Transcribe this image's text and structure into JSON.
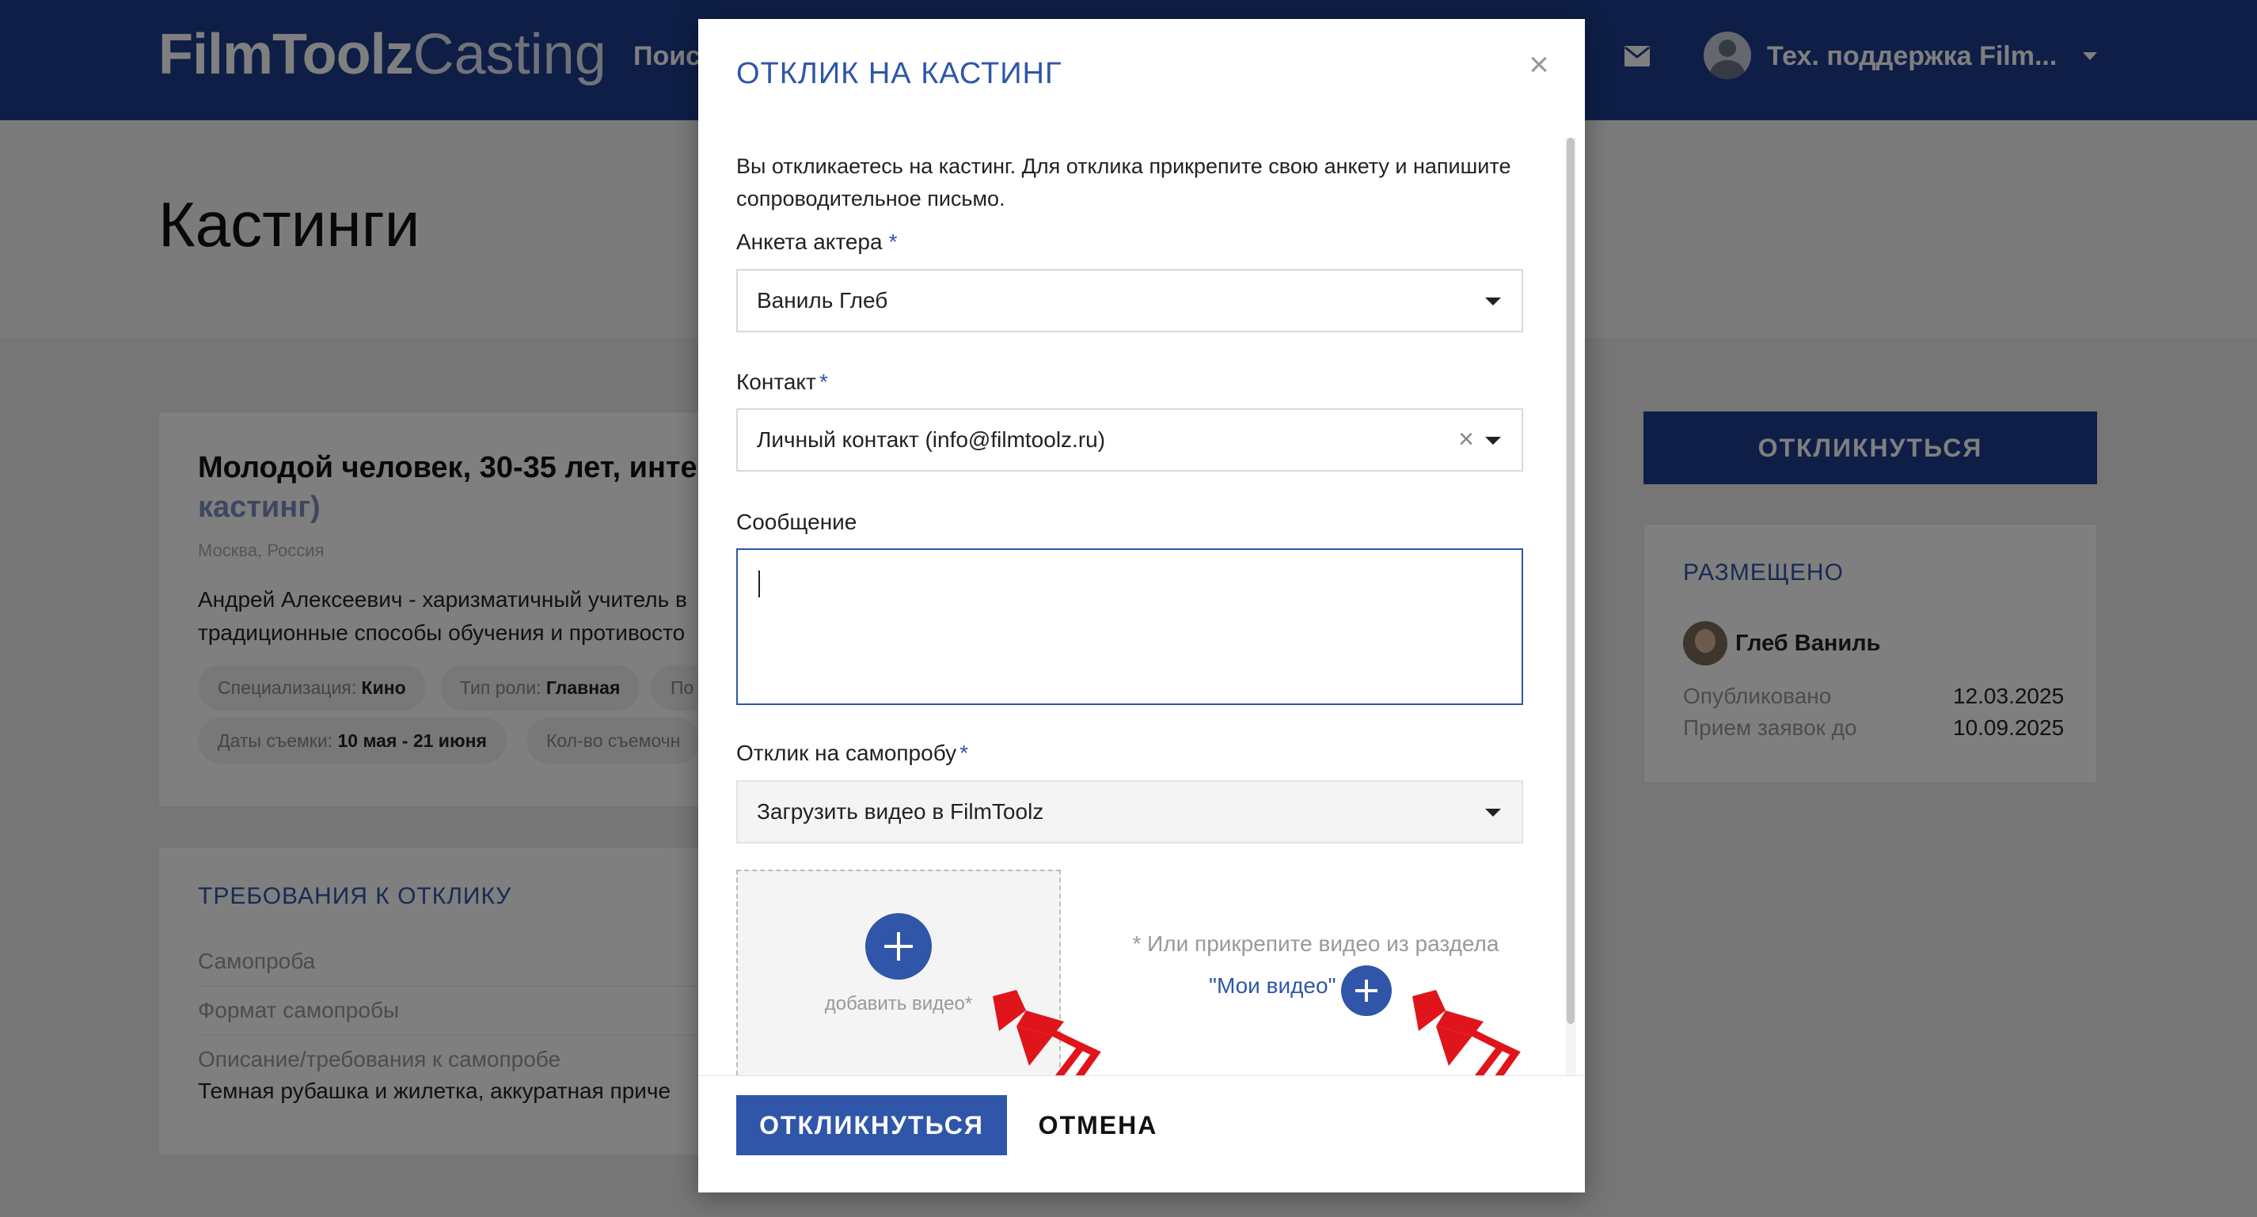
{
  "header": {
    "logo_bold": "FilmToolz",
    "logo_thin": "Casting",
    "nav_search": "Поиск",
    "user_name": "Тех. поддержка Film...",
    "icons": [
      "mail-icon",
      "user-avatar",
      "chevron-down-icon"
    ]
  },
  "page": {
    "title": "Кастинги"
  },
  "casting": {
    "title": "Молодой человек, 30-35 лет, инте",
    "title_tail": "кастинг)",
    "location": "Москва, Россия",
    "description": "Андрей Алексеевич - харизматичный учитель в традиционные способы обучения и противосто",
    "chips": [
      {
        "label": "Специализация:",
        "value": "Кино"
      },
      {
        "label": "Тип роли:",
        "value": "Главная"
      },
      {
        "label": "По",
        "value": ""
      },
      {
        "label": "Даты съемки:",
        "value": "10 мая - 21 июня"
      },
      {
        "label": "Кол-во съемочн",
        "value": ""
      }
    ]
  },
  "requirements": {
    "title": "ТРЕБОВАНИЯ К ОТКЛИКУ",
    "rows": [
      "Самопроба",
      "Формат самопробы",
      "Описание/требования к самопробе"
    ],
    "text": "Темная рубашка и жилетка, аккуратная приче"
  },
  "sidebar": {
    "respond_button": "ОТКЛИКНУТЬСЯ",
    "posted_title": "РАЗМЕЩЕНО",
    "poster_name": "Глеб Ваниль",
    "published_label": "Опубликовано",
    "published_value": "12.03.2025",
    "deadline_label": "Прием заявок до",
    "deadline_value": "10.09.2025"
  },
  "modal": {
    "title": "ОТКЛИК НА КАСТИНГ",
    "close": "×",
    "intro": "Вы откликаетесь на кастинг. Для отклика прикрепите свою анкету и напишите сопроводительное письмо.",
    "profile_label": "Анкета актера",
    "profile_value": "Ваниль Глеб",
    "contact_label": "Контакт",
    "contact_value": "Личный контакт (info@filmtoolz.ru)",
    "message_label": "Сообщение",
    "message_value": "",
    "selftape_label": "Отклик на самопробу",
    "selftape_value": "Загрузить видео в FilmToolz",
    "required_mark": "*",
    "add_video_label": "добавить видео*",
    "alt_text": "* Или прикрепите видео из раздела",
    "my_videos_link": "\"Мои видео\"",
    "submit_button": "ОТКЛИКНУТЬСЯ",
    "cancel_button": "ОТМЕНА",
    "clear_icon": "×"
  },
  "colors": {
    "brand_dark": "#1d3d8c",
    "accent": "#2f56a8",
    "annotation_arrow": "#e0151b"
  }
}
